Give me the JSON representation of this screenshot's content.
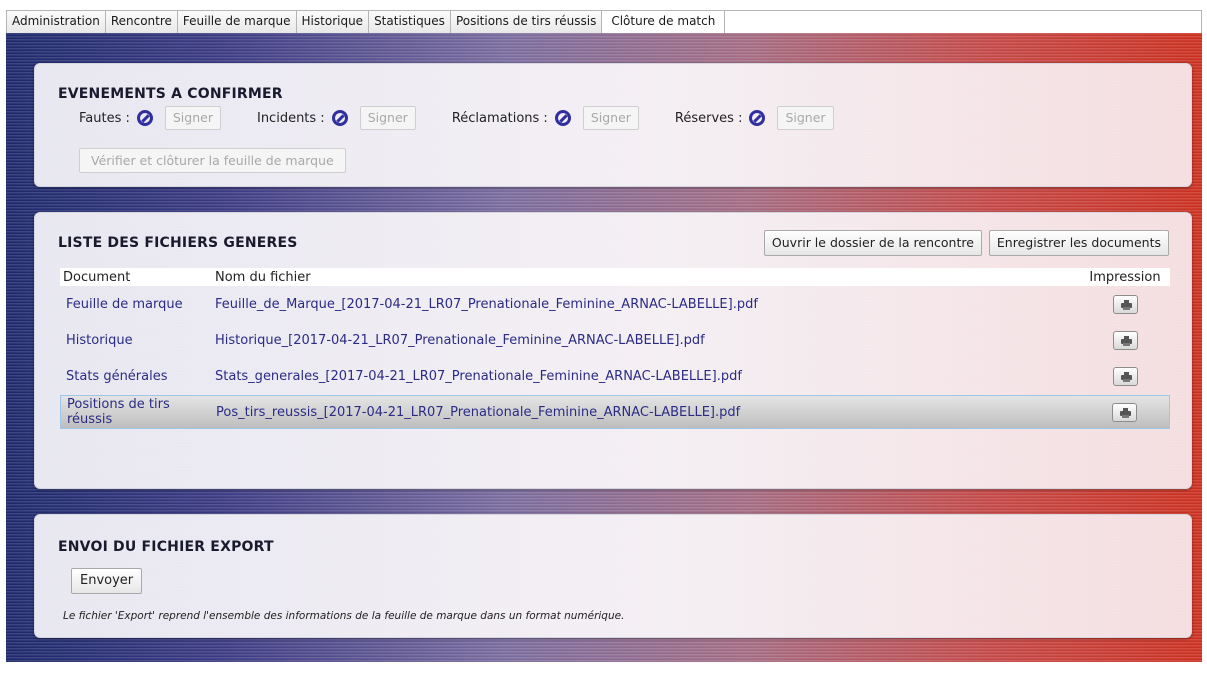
{
  "tabs": [
    {
      "label": "Administration"
    },
    {
      "label": "Rencontre"
    },
    {
      "label": "Feuille de marque"
    },
    {
      "label": "Historique"
    },
    {
      "label": "Statistiques"
    },
    {
      "label": "Positions de tirs réussis"
    },
    {
      "label": "Clôture de match",
      "active": true
    }
  ],
  "events": {
    "title": "EVENEMENTS A CONFIRMER",
    "items": [
      {
        "label": "Fautes :",
        "button": "Signer",
        "icon": "ban-icon"
      },
      {
        "label": "Incidents :",
        "button": "Signer",
        "icon": "ban-icon"
      },
      {
        "label": "Réclamations :",
        "button": "Signer",
        "icon": "ban-icon"
      },
      {
        "label": "Réserves :",
        "button": "Signer",
        "icon": "ban-icon"
      }
    ],
    "verify_button": "Vérifier et clôturer la feuille de marque"
  },
  "files": {
    "title": "LISTE DES FICHIERS GENERES",
    "open_folder_button": "Ouvrir le dossier de la rencontre",
    "save_button": "Enregistrer les documents",
    "columns": {
      "document": "Document",
      "filename": "Nom du fichier",
      "print": "Impression"
    },
    "rows": [
      {
        "document": "Feuille de marque",
        "filename": "Feuille_de_Marque_[2017-04-21_LR07_Prenationale_Feminine_ARNAC-LABELLE].pdf"
      },
      {
        "document": "Historique",
        "filename": "Historique_[2017-04-21_LR07_Prenationale_Feminine_ARNAC-LABELLE].pdf"
      },
      {
        "document": "Stats générales",
        "filename": "Stats_generales_[2017-04-21_LR07_Prenationale_Feminine_ARNAC-LABELLE].pdf"
      },
      {
        "document": "Positions de tirs réussis",
        "filename": "Pos_tirs_reussis_[2017-04-21_LR07_Prenationale_Feminine_ARNAC-LABELLE].pdf",
        "selected": true
      }
    ]
  },
  "export": {
    "title": "ENVOI DU FICHIER EXPORT",
    "send_button": "Envoyer",
    "note": "Le fichier 'Export' reprend l'ensemble des informations de la feuille de marque dans un format numérique."
  },
  "colors": {
    "accent_blue": "#2f2fa0",
    "link_text": "#2b2b86",
    "background_left": "#1e2a6e",
    "background_right": "#d03222"
  }
}
